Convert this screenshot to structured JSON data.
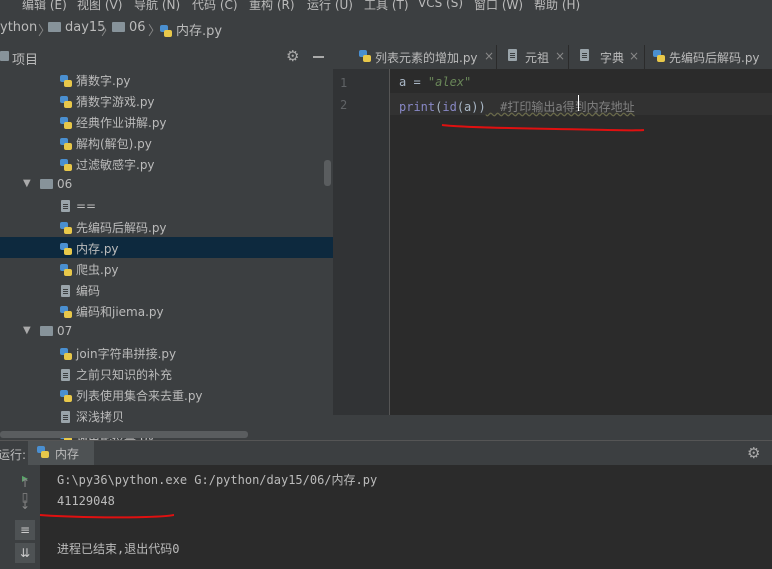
{
  "menubar": {
    "items": [
      "编辑 (E)",
      "视图 (V)",
      "导航 (N)",
      "代码 (C)",
      "重构 (R)",
      "运行 (U)",
      "工具 (T)",
      "VCS (S)",
      "窗口 (W)",
      "帮助 (H)"
    ]
  },
  "breadcrumb": {
    "root": "ython",
    "folder1": "day15",
    "folder2": "06",
    "file": "内存.py"
  },
  "project": {
    "title": "项目",
    "items": [
      {
        "label": "猜数字.py",
        "type": "py"
      },
      {
        "label": "猜数字游戏.py",
        "type": "py"
      },
      {
        "label": "经典作业讲解.py",
        "type": "py"
      },
      {
        "label": "解构(解包).py",
        "type": "py"
      },
      {
        "label": "过滤敏感字.py",
        "type": "py"
      },
      {
        "label": "06",
        "type": "folder"
      },
      {
        "label": "==",
        "type": "file"
      },
      {
        "label": "先编码后解码.py",
        "type": "py"
      },
      {
        "label": "内存.py",
        "type": "py",
        "selected": true
      },
      {
        "label": "爬虫.py",
        "type": "py"
      },
      {
        "label": "编码",
        "type": "file"
      },
      {
        "label": "编码和jiema.py",
        "type": "py"
      },
      {
        "label": "07",
        "type": "folder"
      },
      {
        "label": "join字符串拼接.py",
        "type": "py"
      },
      {
        "label": "之前只知识的补充",
        "type": "file"
      },
      {
        "label": "列表使用集合来去重.py",
        "type": "py"
      },
      {
        "label": "深浅拷贝",
        "type": "file"
      },
      {
        "label": "输电影投票.py",
        "type": "py"
      }
    ]
  },
  "tabs": [
    {
      "label": "列表元素的增加.py",
      "icon": "python-file-icon"
    },
    {
      "label": "元祖",
      "icon": "text-file-icon"
    },
    {
      "label": "字典",
      "icon": "text-file-icon"
    },
    {
      "label": "先编码后解码.py",
      "icon": "python-file-icon"
    }
  ],
  "editor": {
    "line_numbers": [
      "1",
      "2"
    ],
    "line1": {
      "var": "a",
      "op": " = ",
      "str": "\"alex\""
    },
    "line2": {
      "func": "print",
      "p1": "(",
      "call": "id",
      "p2": "(",
      "arg": "a",
      "p3": "))",
      "comment": "  #打印输出a得到内存地址"
    }
  },
  "run": {
    "label": "运行:",
    "tab": "内存",
    "lines": [
      "G:\\py36\\python.exe G:/python/day15/06/内存.py",
      "41129048",
      "",
      "进程已结束,退出代码0"
    ]
  },
  "colors": {
    "keyword": "#8888c6",
    "string": "#6a8759",
    "comment": "#808080",
    "text": "#a9b7c6",
    "annotation": "#e01010"
  }
}
